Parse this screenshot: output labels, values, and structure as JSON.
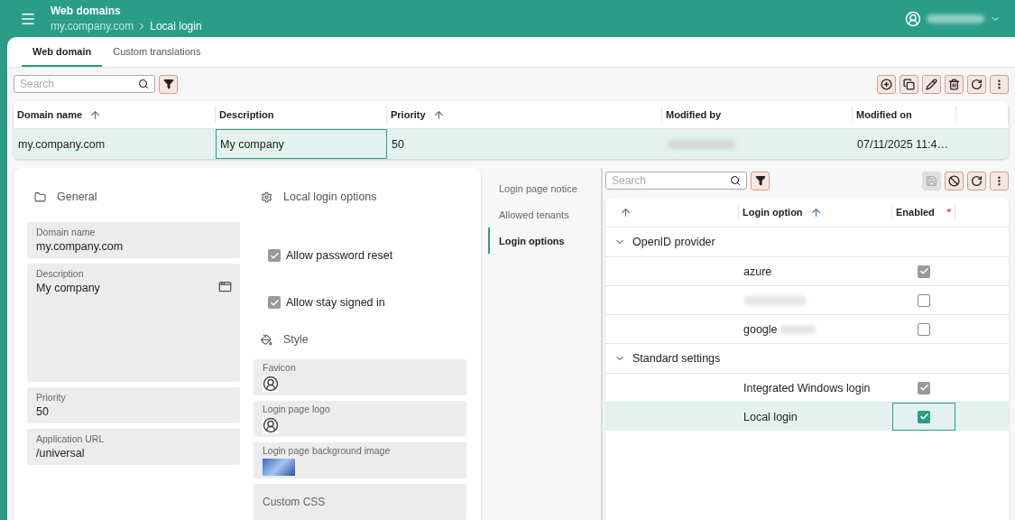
{
  "header": {
    "title": "Web domains",
    "breadcrumb": [
      "my.company.com",
      "Local login"
    ]
  },
  "tabs": [
    {
      "label": "Web domain",
      "selected": true
    },
    {
      "label": "Custom translations",
      "selected": false
    }
  ],
  "search": {
    "placeholder": "Search"
  },
  "toolbar": [
    {
      "kind": "add"
    },
    {
      "kind": "copy"
    },
    {
      "kind": "edit"
    },
    {
      "kind": "delete"
    },
    {
      "kind": "refresh"
    },
    {
      "kind": "more"
    }
  ],
  "grid": {
    "columns": [
      {
        "label": "Domain name",
        "sorted": true
      },
      {
        "label": "Description",
        "sorted": false
      },
      {
        "label": "Priority",
        "sorted": true
      },
      {
        "label": "Modified by",
        "sorted": false
      },
      {
        "label": "Modified on",
        "sorted": false
      }
    ],
    "rows": [
      {
        "domain": "my.company.com",
        "description": "My company",
        "priority": "50",
        "modified_on": "07/11/2025 11:4…",
        "selected": true
      }
    ]
  },
  "general": {
    "title": "General",
    "fields": [
      {
        "label": "Domain name",
        "value": "my.company.com",
        "kind": "text"
      },
      {
        "label": "Description",
        "value": "My company",
        "kind": "multiline"
      },
      {
        "label": "Priority",
        "value": "50",
        "kind": "text"
      },
      {
        "label": "Application URL",
        "value": "/universal",
        "kind": "text"
      }
    ]
  },
  "login_options": {
    "title": "Local login options",
    "checkboxes": [
      {
        "label": "Allow password reset",
        "checked": true
      },
      {
        "label": "Allow stay signed in",
        "checked": true
      }
    ]
  },
  "style": {
    "title": "Style",
    "fields": [
      {
        "label": "Favicon",
        "kind": "avatar"
      },
      {
        "label": "Login page logo",
        "kind": "avatar"
      },
      {
        "label": "Login page background image",
        "kind": "image"
      },
      {
        "label": "Custom CSS",
        "kind": "placeholder"
      }
    ]
  },
  "side_nav": [
    {
      "label": "Login page notice",
      "selected": false
    },
    {
      "label": "Allowed tenants",
      "selected": false
    },
    {
      "label": "Login options",
      "selected": true
    }
  ],
  "options_panel": {
    "search": {
      "placeholder": "Search"
    },
    "toolbar": [
      {
        "kind": "save",
        "disabled": true
      },
      {
        "kind": "cancel",
        "disabled": false
      },
      {
        "kind": "refresh",
        "disabled": false
      },
      {
        "kind": "more",
        "disabled": false
      }
    ],
    "columns": [
      {
        "label": "Login option"
      },
      {
        "label": "Enabled",
        "required_mark": "*"
      }
    ],
    "groups": [
      {
        "label": "OpenID provider",
        "expanded": true,
        "rows": [
          {
            "name": "azure",
            "redacted": false,
            "enabled": true,
            "selected": false
          },
          {
            "redacted": true,
            "enabled": false,
            "selected": false
          },
          {
            "name": "google",
            "redacted": true,
            "enabled": false,
            "selected": false
          }
        ]
      },
      {
        "label": "Standard settings",
        "expanded": true,
        "rows": [
          {
            "name": "Integrated Windows login",
            "redacted": false,
            "enabled": true,
            "selected": false
          },
          {
            "name": "Local login",
            "redacted": false,
            "enabled": true,
            "selected": true
          }
        ]
      }
    ]
  }
}
